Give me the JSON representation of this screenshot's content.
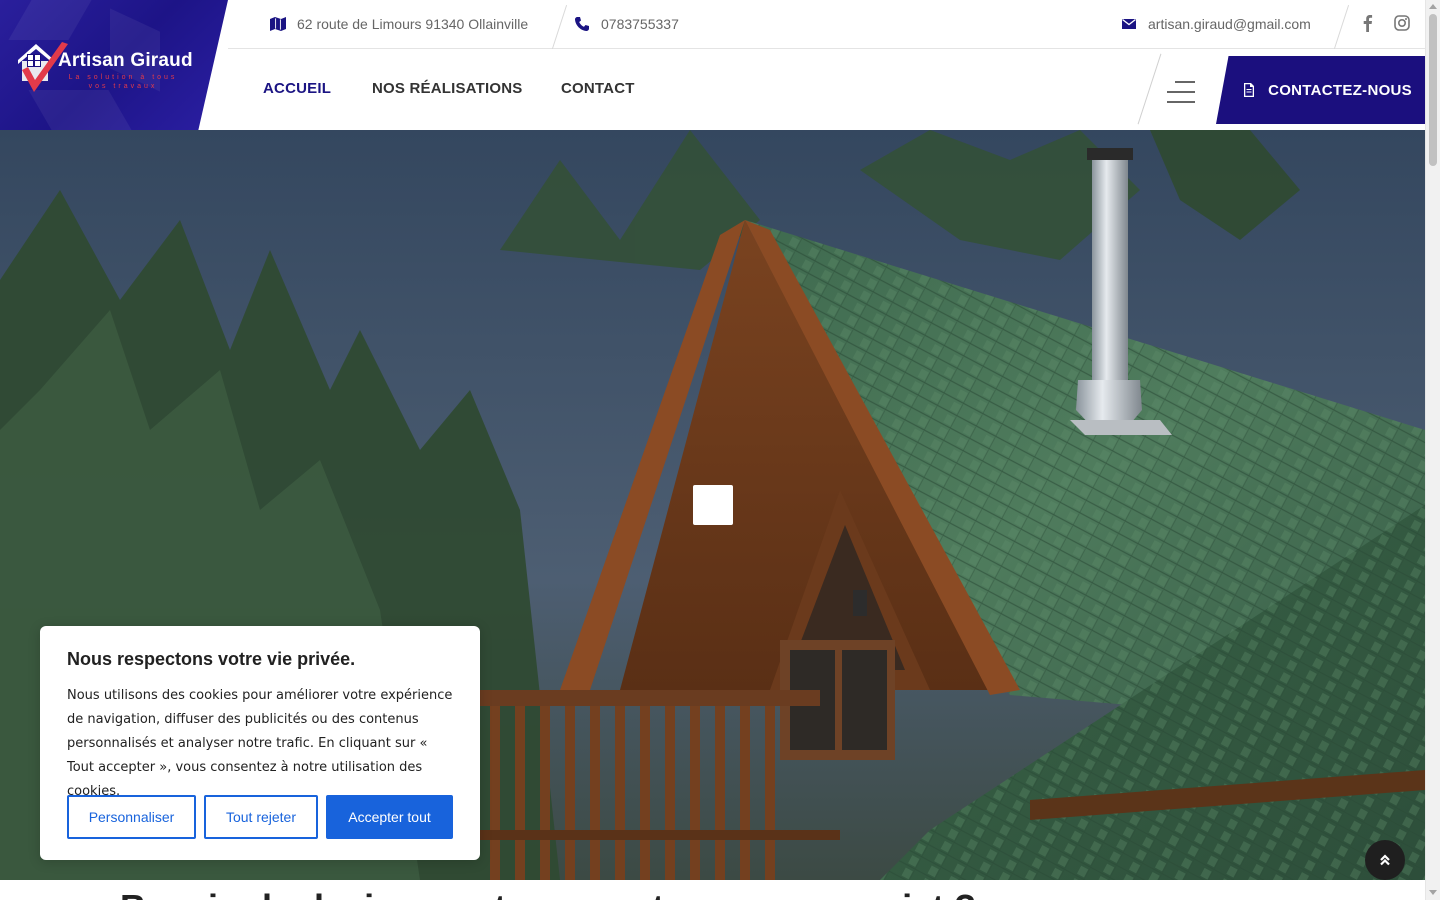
{
  "brand": {
    "name": "Artisan Giraud",
    "tagline": "La solution à tous vos travaux",
    "colors": {
      "primary": "#1b0f7e",
      "accent": "#e23a4a",
      "cookie_blue": "#1863dc"
    }
  },
  "topbar": {
    "address": "62 route de Limours 91340 Ollainville",
    "phone": "0783755337",
    "email": "artisan.giraud@gmail.com",
    "icons": {
      "address": "map-icon",
      "phone": "phone-icon",
      "email": "envelope-icon"
    },
    "social": [
      {
        "name": "facebook",
        "icon": "facebook-icon"
      },
      {
        "name": "instagram",
        "icon": "instagram-icon"
      }
    ]
  },
  "nav": {
    "items": [
      {
        "label": "ACCUEIL",
        "active": true
      },
      {
        "label": "NOS RÉALISATIONS",
        "active": false
      },
      {
        "label": "CONTACT",
        "active": false
      }
    ],
    "cta_label": "CONTACTEZ-NOUS",
    "cta_icon": "document-icon",
    "menu_icon": "hamburger-icon"
  },
  "hero": {
    "image_subject": "wooden-chalet-green-shingle-roof",
    "heading_partial": "Besoin de devis pour tous vos travaux ou projet ?"
  },
  "cookie_banner": {
    "title": "Nous respectons votre vie privée.",
    "body": "Nous utilisons des cookies pour améliorer votre expérience de navigation, diffuser des publicités ou des contenus personnalisés et analyser notre trafic. En cliquant sur « Tout accepter », vous consentez à notre utilisation des cookies.",
    "buttons": {
      "customize": "Personnaliser",
      "reject": "Tout rejeter",
      "accept": "Accepter tout"
    }
  },
  "back_to_top_icon": "double-chevron-up-icon"
}
